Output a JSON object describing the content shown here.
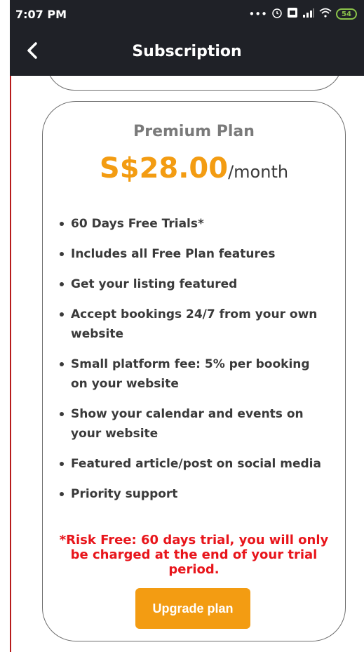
{
  "status_bar": {
    "time": "7:07 PM",
    "icons": [
      "more-icon",
      "alarm-icon",
      "volte-icon",
      "signal-icon",
      "wifi-icon"
    ],
    "battery": "54"
  },
  "app_bar": {
    "title": "Subscription",
    "back_icon": "back-chevron-icon"
  },
  "plan": {
    "name": "Premium Plan",
    "price": "S$28.00",
    "period": "/month",
    "features": [
      "60 Days Free Trials*",
      "Includes all Free Plan features",
      "Get your listing featured",
      "Accept bookings 24/7 from your own website",
      "Small platform fee: 5% per booking on your website",
      "Show your calendar and events on your website",
      "Featured article/post on social media",
      "Priority support"
    ],
    "risk_note": "*Risk Free: 60 days trial, you will only be charged at the end of your trial period.",
    "upgrade_label": "Upgrade plan"
  },
  "colors": {
    "accent": "#f39c12",
    "header_bg": "#1f2127",
    "risk_text": "#e8151b",
    "feature_text": "#3a3a3a"
  }
}
